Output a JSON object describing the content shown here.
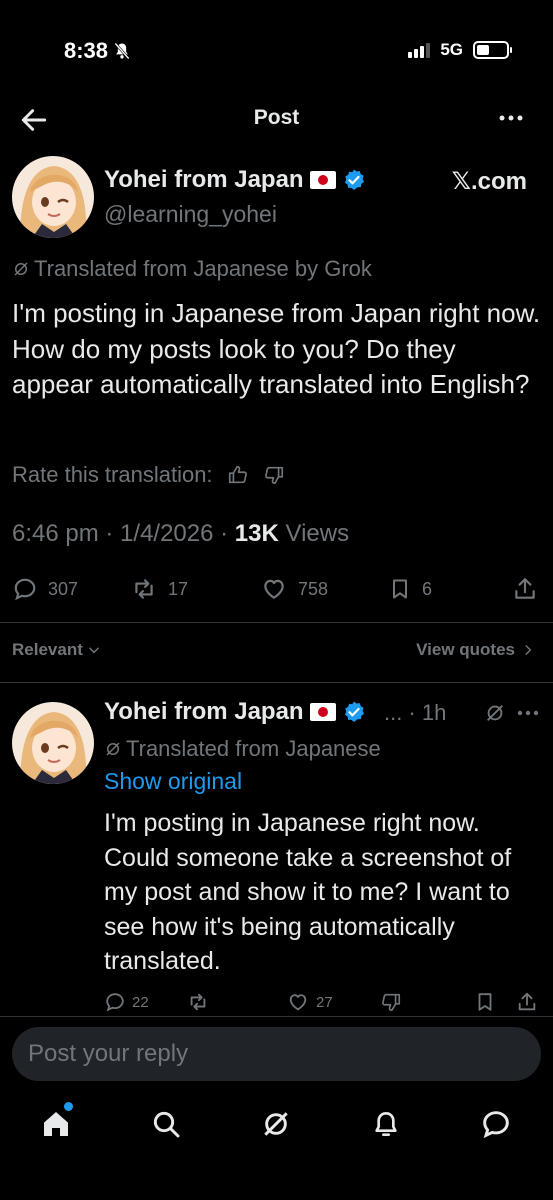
{
  "status_bar": {
    "time": "8:38",
    "network": "5G"
  },
  "header": {
    "title": "Post"
  },
  "post": {
    "author_name": "Yohei from Japan",
    "handle": "@learning_yohei",
    "source_label": "𝕏.com",
    "translated_label": "Translated from Japanese by Grok",
    "text": "I'm posting in Japanese from Japan right now. How do my posts look to you? Do they appear automatically translated into English?",
    "rate_label": "Rate this translation:",
    "time": "6:46 pm",
    "date": "1/4/2026",
    "views_count": "13K",
    "views_label": "Views",
    "stats": {
      "replies": "307",
      "reposts": "17",
      "likes": "758",
      "bookmarks": "6"
    }
  },
  "filter": {
    "sort_label": "Relevant",
    "quotes_label": "View quotes"
  },
  "reply": {
    "author_name": "Yohei from Japan",
    "meta": "... · 1h",
    "translated_label": "Translated from Japanese",
    "show_original": "Show original",
    "text": "I'm posting in Japanese right now. Could someone take a screenshot of my post and show it to me? I want to see how it's being automatically translated.",
    "stats": {
      "replies": "22",
      "likes": "27"
    }
  },
  "composer": {
    "placeholder": "Post your reply"
  },
  "colors": {
    "background": "#000000",
    "accent": "#1d9bf0",
    "muted": "#71767b",
    "text": "#e7e9ea"
  }
}
